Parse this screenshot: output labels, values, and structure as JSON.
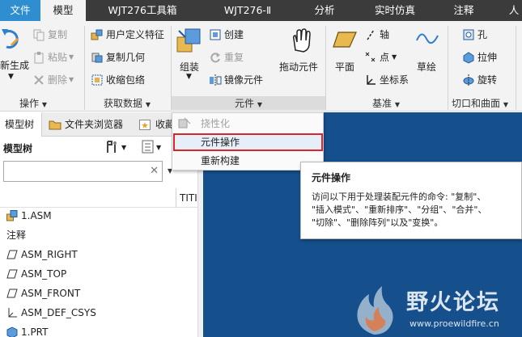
{
  "menubar": {
    "items": [
      "文件",
      "模型",
      "WJT276工具箱",
      "WJT276-Ⅱ",
      "分析",
      "实时仿真",
      "注释",
      "人"
    ],
    "active_index": 1
  },
  "colors": {
    "menubar_bg": "#3b3b3b",
    "file_tab": "#2f8ecf",
    "viewport": "#15508c",
    "highlight_box": "#d9262c"
  },
  "ribbon": {
    "operations": {
      "regen_label": "新生成",
      "copy": "复制",
      "paste": "粘贴",
      "delete": "删除",
      "group_label": "操作"
    },
    "get_data": {
      "udf": "用户定义特征",
      "copy_geometry": "复制几何",
      "shrinkwrap": "收缩包络",
      "group_label": "获取数据"
    },
    "component": {
      "assemble": "组装",
      "create": "创建",
      "repeat": "重复",
      "mirror": "镜像元件",
      "drag": "拖动元件",
      "group_label": "元件"
    },
    "datum": {
      "plane": "平面",
      "axis": "轴",
      "point": "点",
      "csys": "坐标系",
      "sketch": "草绘",
      "group_label": "基准"
    },
    "cut_surface": {
      "hole": "孔",
      "extrude": "拉伸",
      "revolve": "旋转",
      "group_label": "切口和曲面"
    }
  },
  "left_panel": {
    "tabs": [
      "模型树",
      "文件夹浏览器",
      "收藏"
    ],
    "tree_title": "模型树",
    "search_placeholder": "",
    "column_header": "TITI",
    "items": [
      {
        "label": "1.ASM",
        "icon": "assembly-icon"
      },
      {
        "label": "注释",
        "icon": "none"
      },
      {
        "label": "ASM_RIGHT",
        "icon": "datum-plane-icon"
      },
      {
        "label": "ASM_TOP",
        "icon": "datum-plane-icon"
      },
      {
        "label": "ASM_FRONT",
        "icon": "datum-plane-icon"
      },
      {
        "label": "ASM_DEF_CSYS",
        "icon": "csys-icon"
      },
      {
        "label": "1.PRT",
        "icon": "part-icon"
      }
    ]
  },
  "dropdown": {
    "items": [
      "挠性化",
      "元件操作",
      "重新构建"
    ]
  },
  "tooltip": {
    "title": "元件操作",
    "lines": [
      "访问以下用于处理装配元件的命令: \"复制\"、",
      "\"插入模式\"、\"重新排序\"、\"分组\"、\"合并\"、",
      "\"切除\"、\"删除阵列\"以及\"变换\"。"
    ]
  },
  "watermark": {
    "title": "野火论坛",
    "url": "www.proewildfire.cn"
  }
}
